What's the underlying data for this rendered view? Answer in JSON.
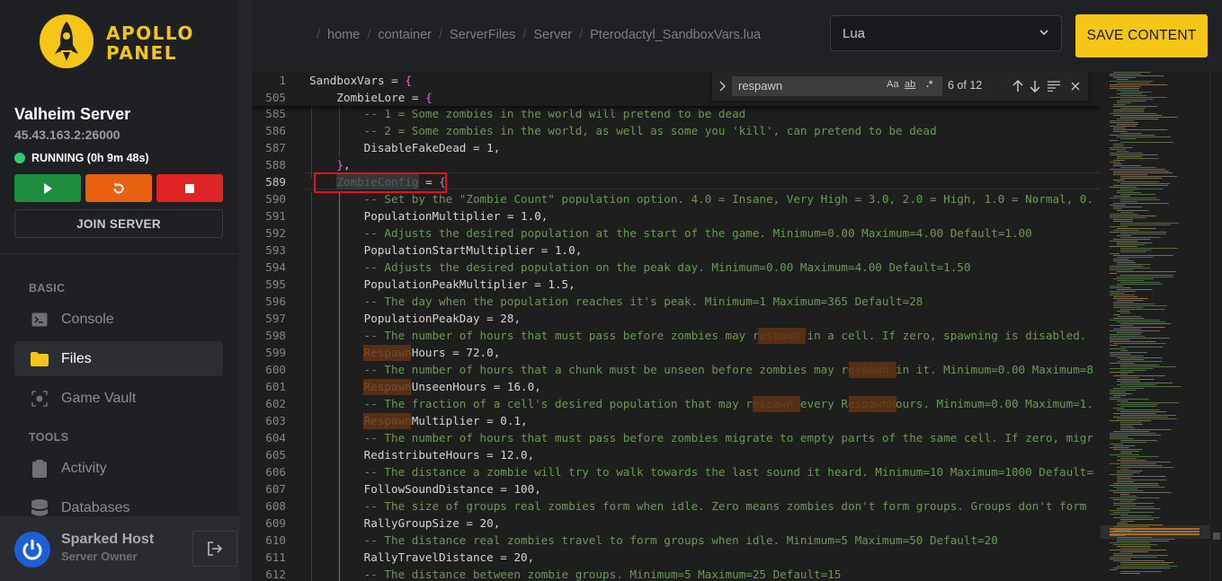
{
  "brand": {
    "name_line1": "APOLLO",
    "name_line2": "PANEL",
    "color": "#f5c518"
  },
  "server": {
    "name": "Valheim Server",
    "address": "45.43.163.2:26000",
    "status": "RUNNING (0h 9m 48s)",
    "join_label": "JOIN SERVER"
  },
  "nav": {
    "basic_label": "BASIC",
    "tools_label": "TOOLS",
    "items": [
      {
        "label": "Console",
        "icon": "terminal-icon"
      },
      {
        "label": "Files",
        "icon": "folder-icon"
      },
      {
        "label": "Game Vault",
        "icon": "vault-icon"
      },
      {
        "label": "Activity",
        "icon": "clipboard-icon"
      },
      {
        "label": "Databases",
        "icon": "database-icon"
      }
    ]
  },
  "user": {
    "name": "Sparked Host",
    "role": "Server Owner"
  },
  "breadcrumb": [
    "home",
    "container",
    "ServerFiles",
    "Server",
    "Pterodactyl_SandboxVars.lua"
  ],
  "editor_toolbar": {
    "language": "Lua",
    "save_label": "SAVE CONTENT"
  },
  "find": {
    "query": "respawn",
    "count": "6 of 12",
    "match_case": "Aa",
    "whole_word": "ab",
    "regex": ".*"
  },
  "code_lines": [
    {
      "n": "1",
      "text": "SandboxVars = {"
    },
    {
      "n": "505",
      "text": "    ZombieLore = {"
    },
    {
      "n": "585",
      "text": "        -- 1 = Some zombies in the world will pretend to be dead"
    },
    {
      "n": "586",
      "text": "        -- 2 = Some zombies in the world, as well as some you 'kill', can pretend to be dead"
    },
    {
      "n": "587",
      "text": "        DisableFakeDead = 1,"
    },
    {
      "n": "588",
      "text": "    },"
    },
    {
      "n": "589",
      "text": "    ZombieConfig = {"
    },
    {
      "n": "590",
      "text": "        -- Set by the \"Zombie Count\" population option. 4.0 = Insane, Very High = 3.0, 2.0 = High, 1.0 = Normal, 0."
    },
    {
      "n": "591",
      "text": "        PopulationMultiplier = 1.0,"
    },
    {
      "n": "592",
      "text": "        -- Adjusts the desired population at the start of the game. Minimum=0.00 Maximum=4.00 Default=1.00"
    },
    {
      "n": "593",
      "text": "        PopulationStartMultiplier = 1.0,"
    },
    {
      "n": "594",
      "text": "        -- Adjusts the desired population on the peak day. Minimum=0.00 Maximum=4.00 Default=1.50"
    },
    {
      "n": "595",
      "text": "        PopulationPeakMultiplier = 1.5,"
    },
    {
      "n": "596",
      "text": "        -- The day when the population reaches it's peak. Minimum=1 Maximum=365 Default=28"
    },
    {
      "n": "597",
      "text": "        PopulationPeakDay = 28,"
    },
    {
      "n": "598",
      "text": "        -- The number of hours that must pass before zombies may respawn in a cell. If zero, spawning is disabled."
    },
    {
      "n": "599",
      "text": "        RespawnHours = 72.0,"
    },
    {
      "n": "600",
      "text": "        -- The number of hours that a chunk must be unseen before zombies may respawn in it. Minimum=0.00 Maximum=8"
    },
    {
      "n": "601",
      "text": "        RespawnUnseenHours = 16.0,"
    },
    {
      "n": "602",
      "text": "        -- The fraction of a cell's desired population that may respawn every RespawnHours. Minimum=0.00 Maximum=1."
    },
    {
      "n": "603",
      "text": "        RespawnMultiplier = 0.1,"
    },
    {
      "n": "604",
      "text": "        -- The number of hours that must pass before zombies migrate to empty parts of the same cell. If zero, migr"
    },
    {
      "n": "605",
      "text": "        RedistributeHours = 12.0,"
    },
    {
      "n": "606",
      "text": "        -- The distance a zombie will try to walk towards the last sound it heard. Minimum=10 Maximum=1000 Default="
    },
    {
      "n": "607",
      "text": "        FollowSoundDistance = 100,"
    },
    {
      "n": "608",
      "text": "        -- The size of groups real zombies form when idle. Zero means zombies don't form groups. Groups don't form"
    },
    {
      "n": "609",
      "text": "        RallyGroupSize = 20,"
    },
    {
      "n": "610",
      "text": "        -- The distance real zombies travel to form groups when idle. Minimum=5 Maximum=50 Default=20"
    },
    {
      "n": "611",
      "text": "        RallyTravelDistance = 20,"
    },
    {
      "n": "612",
      "text": "        -- The distance between zombie groups. Minimum=5 Maximum=25 Default=15"
    }
  ]
}
